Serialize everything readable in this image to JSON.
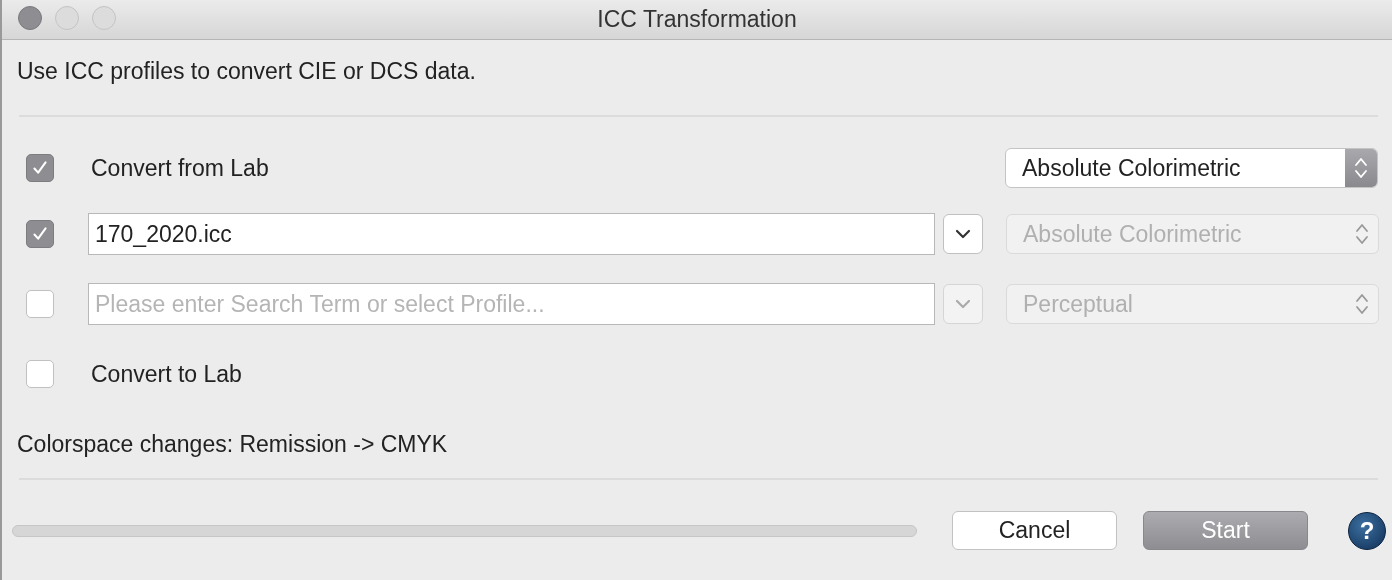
{
  "window": {
    "title": "ICC Transformation"
  },
  "description": "Use ICC profiles to convert CIE or DCS data.",
  "rows": [
    {
      "kind": "label",
      "checked": true,
      "label": "Convert from Lab",
      "intent": {
        "value": "Absolute Colorimetric",
        "disabled": false
      }
    },
    {
      "kind": "profile",
      "checked": true,
      "profile": {
        "value": "170_2020.icc"
      },
      "dropdown_disabled": false,
      "intent": {
        "value": "Absolute Colorimetric",
        "disabled": true
      }
    },
    {
      "kind": "profile",
      "checked": false,
      "profile": {
        "placeholder": "Please enter Search Term or select Profile..."
      },
      "dropdown_disabled": true,
      "intent": {
        "value": "Perceptual",
        "disabled": true
      }
    },
    {
      "kind": "label",
      "checked": false,
      "label": "Convert to Lab"
    }
  ],
  "status": "Colorspace changes: Remission -> CMYK",
  "progress": {
    "level": 0
  },
  "buttons": [
    {
      "label": "Cancel",
      "default": false
    },
    {
      "label": "Start",
      "default": true
    }
  ],
  "help": {
    "label": "?"
  }
}
